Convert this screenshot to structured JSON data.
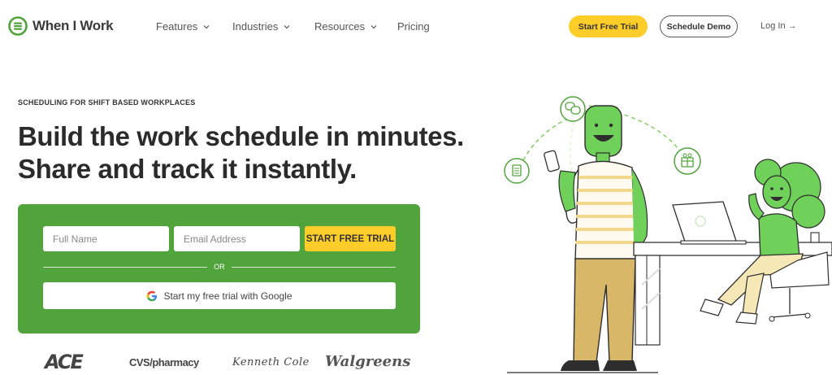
{
  "brand": {
    "name": "When I Work",
    "accent": "#51a33b",
    "cta_color": "#ffcd29"
  },
  "nav": {
    "menu": [
      {
        "label": "Features",
        "dropdown": true
      },
      {
        "label": "Industries",
        "dropdown": true
      },
      {
        "label": "Resources",
        "dropdown": true
      },
      {
        "label": "Pricing",
        "dropdown": false
      }
    ],
    "start_trial": "Start Free Trial",
    "schedule_demo": "Schedule Demo",
    "login": "Log In →"
  },
  "hero": {
    "eyebrow": "SCHEDULING FOR SHIFT BASED WORKPLACES",
    "headline_line1": "Build the work schedule in minutes.",
    "headline_line2": "Share and track it instantly.",
    "form": {
      "name_placeholder": "Full Name",
      "email_placeholder": "Email Address",
      "submit_label": "START FREE TRIAL",
      "or_label": "OR",
      "google_label": "Start my free trial with Google"
    }
  },
  "customer_logos": [
    "ACE",
    "CVS/pharmacy",
    "Kenneth Cole",
    "Walgreens"
  ],
  "icons": [
    "when-i-work-logo-icon",
    "chevron-down-icon",
    "google-icon",
    "chat-bubbles-icon",
    "document-icon",
    "gift-icon"
  ]
}
